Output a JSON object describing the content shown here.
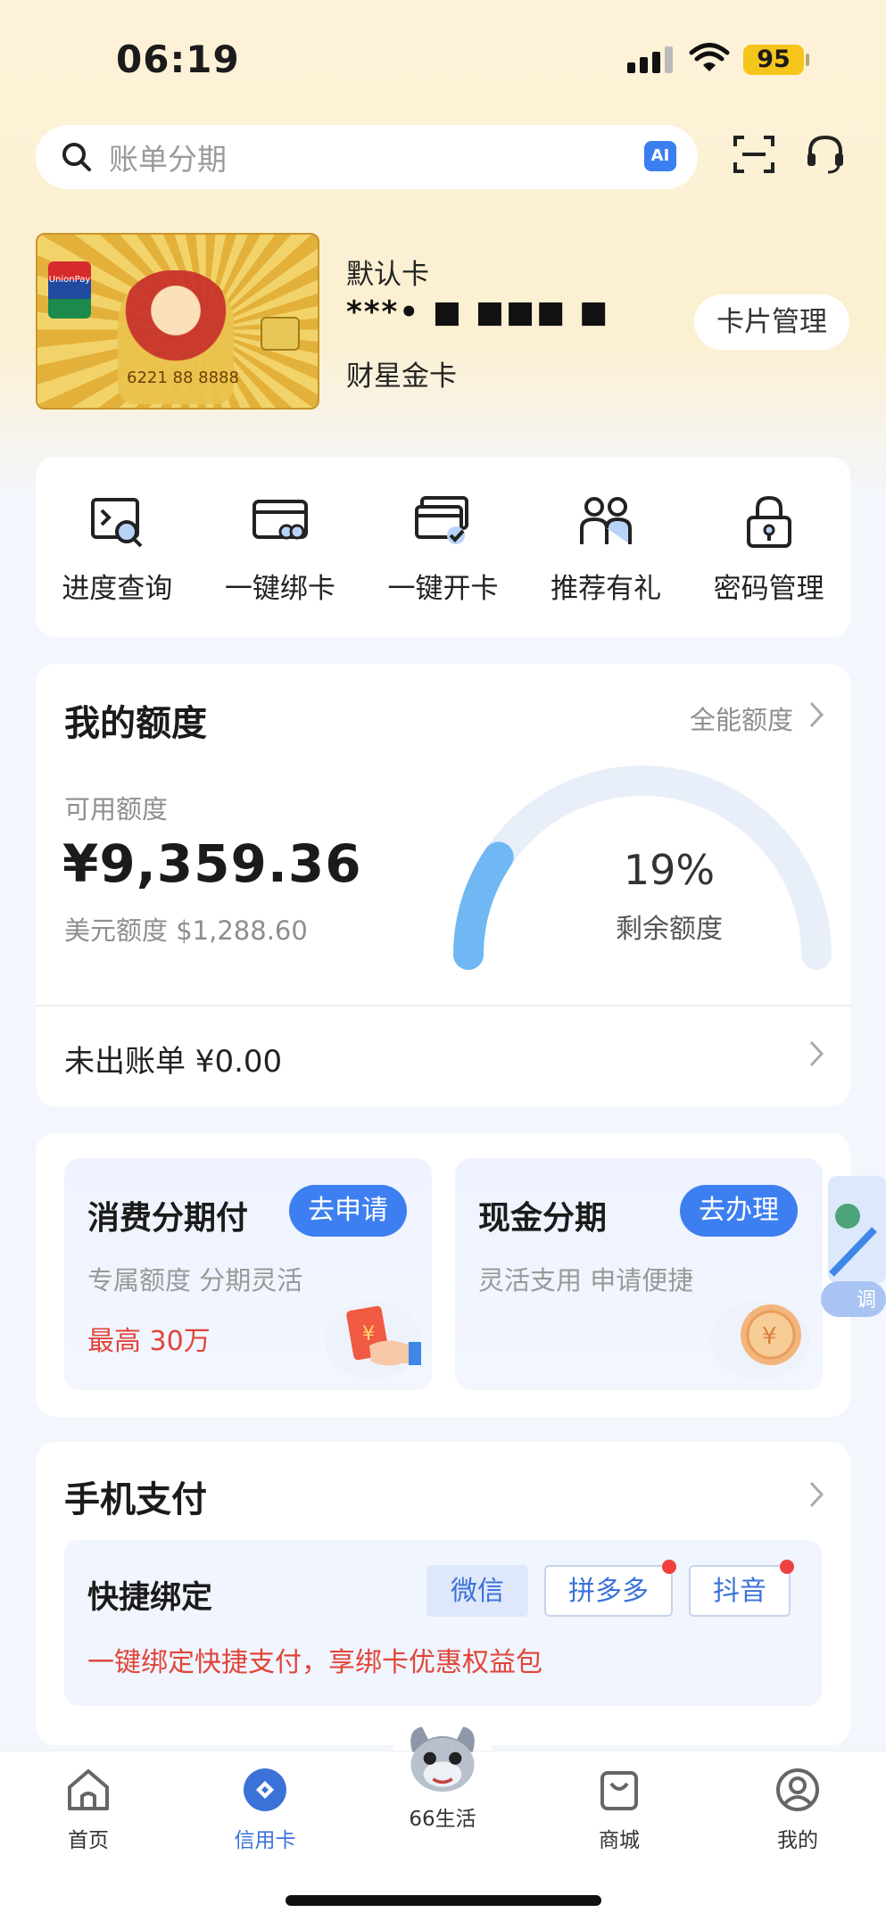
{
  "status_bar": {
    "time": "06:19",
    "battery": "95"
  },
  "search": {
    "placeholder": "账单分期",
    "ai_badge": "AI"
  },
  "card": {
    "label": "默认卡",
    "number_masked": "***• ■ ■■■ ■",
    "name": "财星金卡",
    "manage_button": "卡片管理",
    "image_number_text": "6221 88 8888"
  },
  "quick_actions": [
    {
      "label": "进度查询",
      "icon": "progress-search-icon"
    },
    {
      "label": "一键绑卡",
      "icon": "bind-card-icon"
    },
    {
      "label": "一键开卡",
      "icon": "activate-card-icon"
    },
    {
      "label": "推荐有礼",
      "icon": "refer-gift-icon"
    },
    {
      "label": "密码管理",
      "icon": "lock-icon"
    }
  ],
  "credit": {
    "title": "我的额度",
    "all_limit_link": "全能额度",
    "available_label": "可用额度",
    "available_amount": "¥9,359.36",
    "usd_label": "美元额度 $1,288.60",
    "remaining_percent": 19,
    "remaining_percent_text": "19%",
    "remaining_label": "剩余额度",
    "unbilled": "未出账单 ¥0.00"
  },
  "installments": [
    {
      "title": "消费分期付",
      "button": "去申请",
      "subtitle": "专属额度  分期灵活",
      "highlight": "最高  30万"
    },
    {
      "title": "现金分期",
      "button": "去办理",
      "subtitle": "灵活支用  申请便捷",
      "highlight": ""
    }
  ],
  "side_float_label": "调",
  "mobile_pay": {
    "title": "手机支付",
    "quick_bind_title": "快捷绑定",
    "tags": [
      "微信",
      "拼多多",
      "抖音"
    ],
    "promo": "一键绑定快捷支付，享绑卡优惠权益包"
  },
  "tabbar": [
    {
      "label": "首页",
      "icon": "home-icon"
    },
    {
      "label": "信用卡",
      "icon": "credit-card-tab-icon"
    },
    {
      "label": "66生活",
      "icon": "mascot-icon"
    },
    {
      "label": "商城",
      "icon": "shopping-bag-icon"
    },
    {
      "label": "我的",
      "icon": "profile-icon"
    }
  ],
  "colors": {
    "accent": "#3d7ff0",
    "highlight_red": "#e0453b",
    "gauge_track": "#e9eff9",
    "gauge_fill": "#6fb8f3"
  }
}
